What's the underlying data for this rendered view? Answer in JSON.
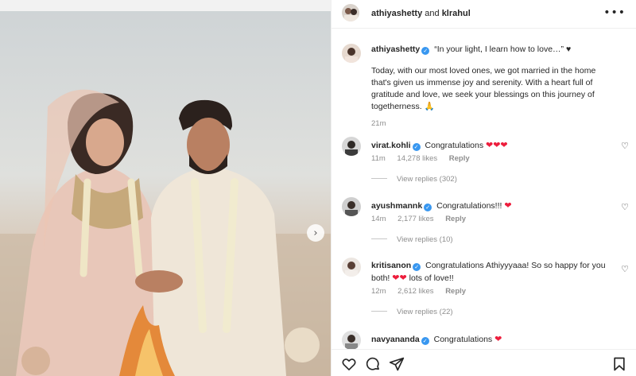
{
  "post": {
    "header": {
      "author": "athiyashetty",
      "joiner": "and",
      "coauthor": "klrahul"
    },
    "caption": {
      "username": "athiyashetty",
      "quote": "“In your light, I learn how to love…” ♥",
      "body": "Today, with our most loved ones, we got married in the home that's given us immense joy and serenity. With a heart full of gratitude and love, we seek your blessings on this journey of togetherness. 🙏",
      "time": "21m"
    },
    "comments": [
      {
        "username": "virat.kohli",
        "text": "Congratulations",
        "hearts": "❤❤❤",
        "time": "11m",
        "likes": "14,278 likes",
        "reply": "Reply",
        "view_replies": "View replies (302)"
      },
      {
        "username": "ayushmannk",
        "text": "Congratulations!!!",
        "hearts": "❤",
        "time": "14m",
        "likes": "2,177 likes",
        "reply": "Reply",
        "view_replies": "View replies (10)"
      },
      {
        "username": "kritisanon",
        "text": "Congratulations Athiyyyaaa! So so happy for you both!",
        "hearts": "❤❤",
        "text_after": "lots of love!!",
        "time": "12m",
        "likes": "2,612 likes",
        "reply": "Reply",
        "view_replies": "View replies (22)"
      },
      {
        "username": "navyananda",
        "text": "Congratulations",
        "hearts": "❤"
      }
    ]
  },
  "icons": {
    "more": "more-options-icon",
    "next": "chevron-right-icon",
    "like": "heart-icon",
    "comment": "comment-icon",
    "share": "paper-plane-icon",
    "save": "bookmark-icon",
    "verified": "verified-badge-icon"
  },
  "glyphs": {
    "more": "•••",
    "next": "›",
    "verified": "✓",
    "heart_outline": "♡"
  },
  "colors": {
    "verified": "#3897f0",
    "heart": "#ed1d3c",
    "muted": "#8e8e8e"
  }
}
